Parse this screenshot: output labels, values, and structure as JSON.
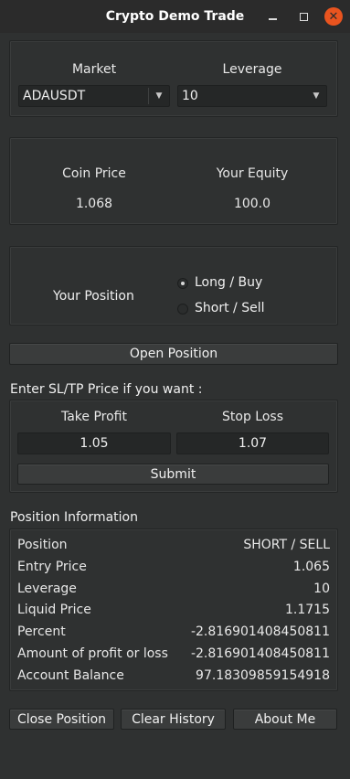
{
  "window": {
    "title": "Crypto Demo Trade"
  },
  "market": {
    "market_label": "Market",
    "leverage_label": "Leverage",
    "market_value": "ADAUSDT",
    "leverage_value": "10"
  },
  "prices": {
    "coin_price_label": "Coin Price",
    "equity_label": "Your Equity",
    "coin_price_value": "1.068",
    "equity_value": "100.0"
  },
  "position": {
    "label": "Your Position",
    "long_label": "Long / Buy",
    "short_label": "Short / Sell",
    "selected": "long"
  },
  "open_position_button": "Open Position",
  "sltp": {
    "heading": "Enter SL/TP Price if you want :",
    "take_profit_label": "Take Profit",
    "stop_loss_label": "Stop Loss",
    "take_profit_value": "1.05",
    "stop_loss_value": "1.07",
    "submit_label": "Submit"
  },
  "info": {
    "heading": "Position Information",
    "rows": [
      {
        "label": "Position",
        "value": "SHORT / SELL"
      },
      {
        "label": "Entry Price",
        "value": "1.065"
      },
      {
        "label": "Leverage",
        "value": "10"
      },
      {
        "label": "Liquid Price",
        "value": "1.1715"
      },
      {
        "label": "Percent",
        "value": "-2.816901408450811"
      },
      {
        "label": "Amount of profit or loss",
        "value": "-2.816901408450811"
      },
      {
        "label": "Account Balance",
        "value": "97.18309859154918"
      }
    ]
  },
  "footer": {
    "close_position": "Close Position",
    "clear_history": "Clear History",
    "about_me": "About Me"
  }
}
